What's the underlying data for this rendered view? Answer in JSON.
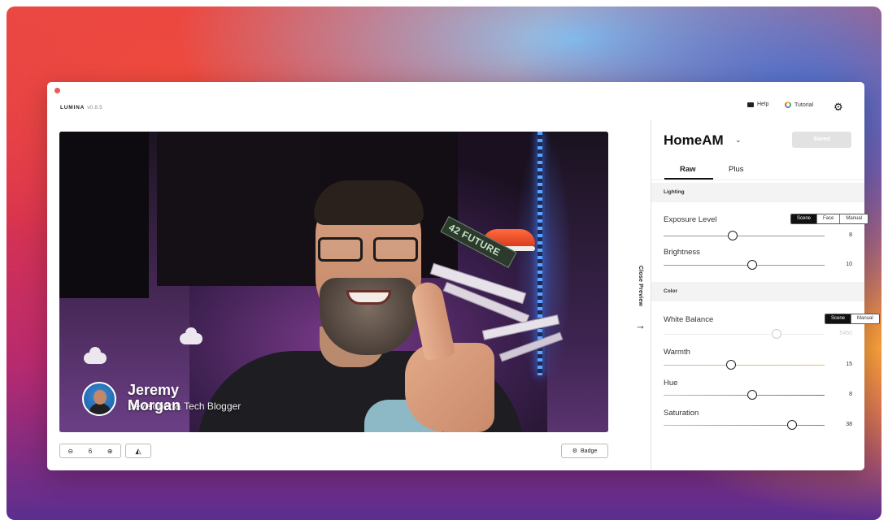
{
  "app": {
    "brand": "LUMINA",
    "version": "v0.8.5",
    "help_label": "Help",
    "tutorial_label": "Tutorial"
  },
  "preview": {
    "badge": {
      "first_name": "Jeremy",
      "last_name": "Morgan",
      "role": "Developer & Tech Blogger"
    },
    "book_text": "42 FUTURE",
    "zoom_value": "6",
    "badge_button_label": "Badge",
    "close_preview_label": "Close Preview"
  },
  "sidebar": {
    "scene_name": "HomeAM",
    "saved_label": "Saved",
    "tabs": [
      {
        "label": "Raw",
        "active": true
      },
      {
        "label": "Plus",
        "active": false
      }
    ],
    "sections": {
      "lighting": "Lighting",
      "color": "Color"
    },
    "controls": {
      "exposure": {
        "label": "Exposure Level",
        "modes": [
          "Scene",
          "Face",
          "Manual"
        ],
        "selected_mode": "Scene",
        "value": "8",
        "level": 0.43
      },
      "brightness": {
        "label": "Brightness",
        "value": "10",
        "level": 0.55
      },
      "white_balance": {
        "label": "White Balance",
        "modes": [
          "Scene",
          "Manual"
        ],
        "selected_mode": "Scene",
        "value": "5450",
        "level": 0.7,
        "disabled": true
      },
      "warmth": {
        "label": "Warmth",
        "value": "15",
        "level": 0.42
      },
      "hue": {
        "label": "Hue",
        "value": "8",
        "level": 0.55
      },
      "saturation": {
        "label": "Saturation",
        "value": "38",
        "level": 0.8
      }
    }
  },
  "colors": {
    "accent_dark": "#111111",
    "saved_button_bg": "#e2e2e2",
    "warmth_track": "#e6c34a",
    "hue_track": "#3d8f4f",
    "saturation_track": "#d9534f",
    "tutorial_icon": "#f2b233"
  },
  "icons": [
    "mail-icon",
    "tutorial-icon",
    "gear-icon",
    "zoom-out-icon",
    "zoom-in-icon",
    "mirror-icon",
    "badge-gear-icon",
    "arrow-right-icon",
    "chevron-down-icon"
  ]
}
